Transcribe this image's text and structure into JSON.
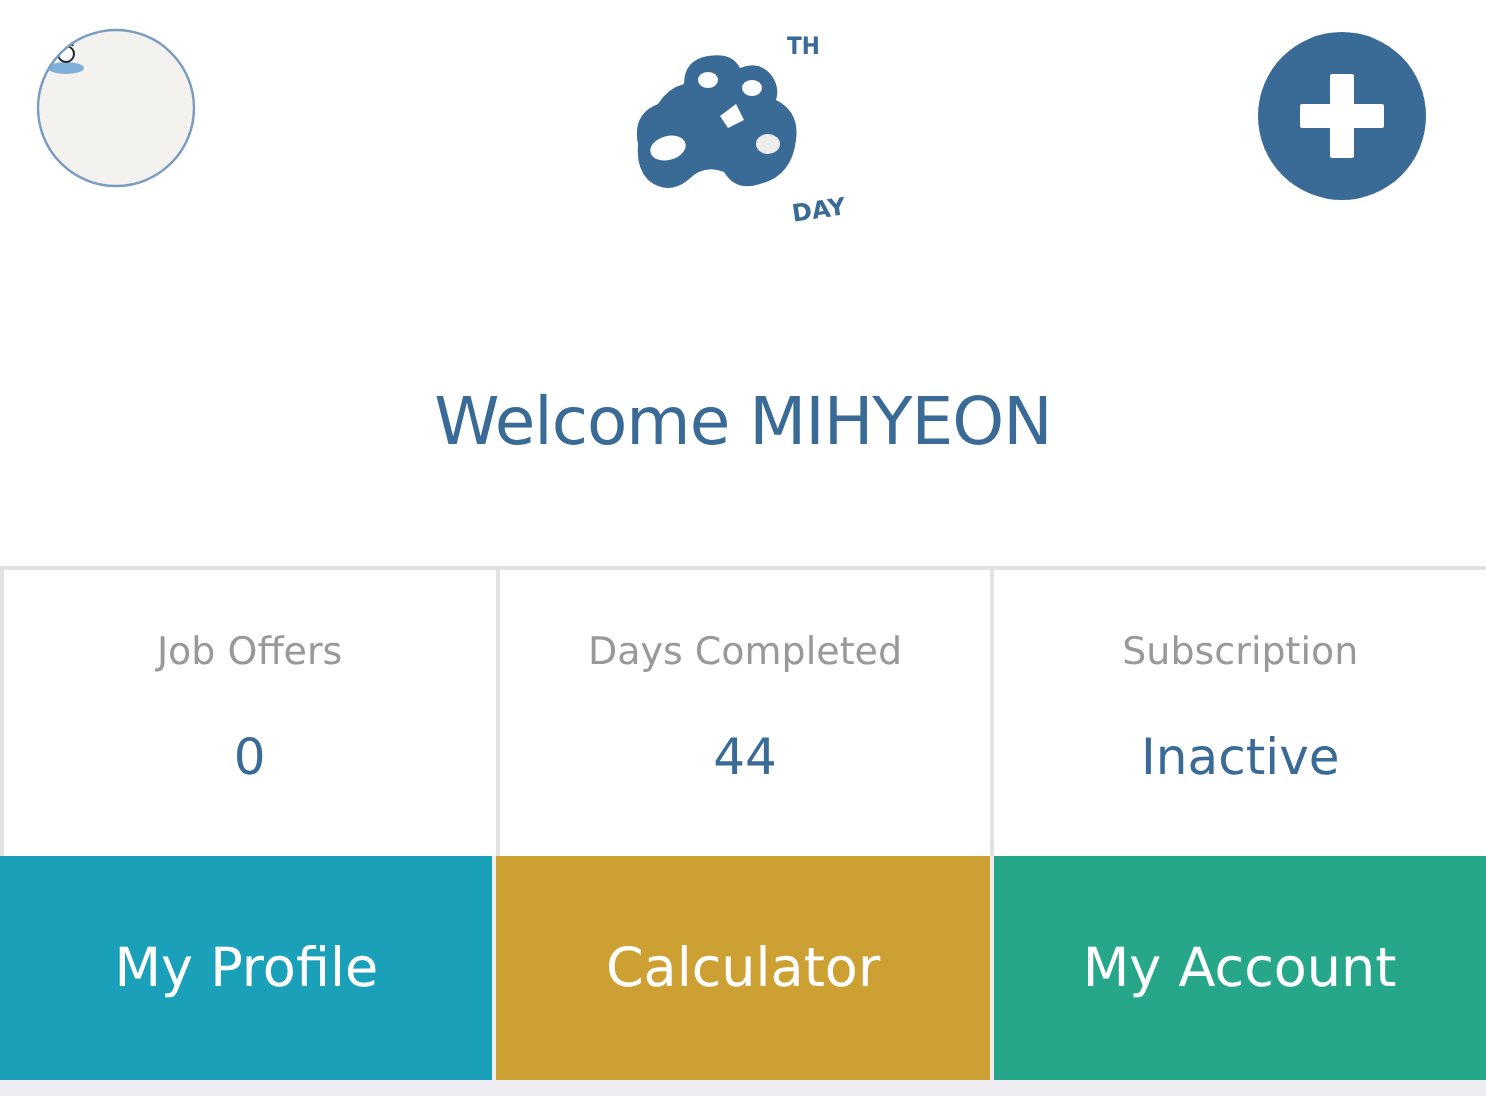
{
  "header": {
    "logo": {
      "superscript": "TH",
      "subtitle": "DAY"
    },
    "add_button": {
      "kind": "plus"
    }
  },
  "welcome": "Welcome MIHYEON",
  "stats": [
    {
      "label": "Job Offers",
      "value": "0"
    },
    {
      "label": "Days Completed",
      "value": "44"
    },
    {
      "label": "Subscription",
      "value": "Inactive"
    }
  ],
  "actions": [
    {
      "label": "My Profile",
      "color": "#1aa0b8"
    },
    {
      "label": "Calculator",
      "color": "#cda033"
    },
    {
      "label": "My Account",
      "color": "#27a789"
    }
  ]
}
